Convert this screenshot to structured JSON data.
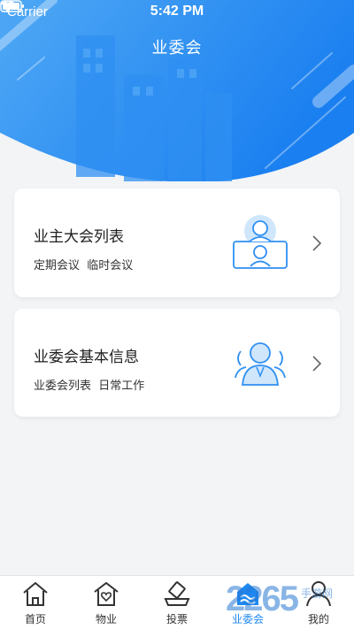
{
  "status_bar": {
    "carrier": "Carrier",
    "time": "5:42 PM"
  },
  "header": {
    "title": "业委会",
    "accent_color": "#1e88f0"
  },
  "cards": [
    {
      "title": "业主大会列表",
      "subtitle": "定期会议  临时会议",
      "icon": "meeting-icon"
    },
    {
      "title": "业委会基本信息",
      "subtitle": "业委会列表  日常工作",
      "icon": "committee-icon"
    }
  ],
  "tabbar": {
    "tabs": [
      {
        "label": "首页",
        "icon": "home-icon"
      },
      {
        "label": "物业",
        "icon": "property-icon"
      },
      {
        "label": "投票",
        "icon": "vote-icon"
      },
      {
        "label": "业委会",
        "icon": "committee-tab-icon",
        "active": true
      },
      {
        "label": "我的",
        "icon": "profile-icon"
      }
    ]
  },
  "watermark": {
    "text": "2265",
    "suffix": "手游网"
  }
}
